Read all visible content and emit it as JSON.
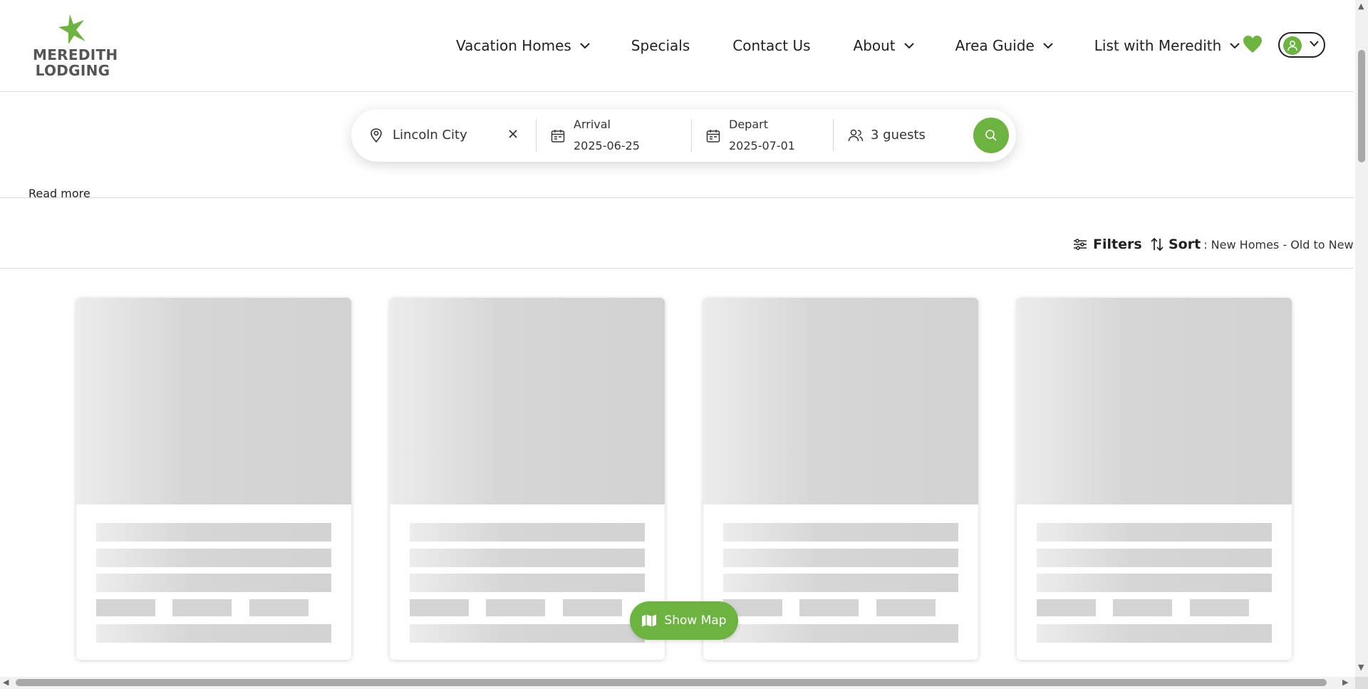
{
  "brand": {
    "line1": "MEREDITH",
    "line2": "LODGING",
    "accent_color": "#6cb33f"
  },
  "nav": {
    "items": [
      {
        "label": "Vacation Homes",
        "has_dropdown": true
      },
      {
        "label": "Specials",
        "has_dropdown": false
      },
      {
        "label": "Contact Us",
        "has_dropdown": false
      },
      {
        "label": "About",
        "has_dropdown": true
      },
      {
        "label": "Area Guide",
        "has_dropdown": true
      },
      {
        "label": "List with Meredith",
        "has_dropdown": true
      }
    ],
    "favorites_icon": "heart-icon",
    "account_icon": "user-icon"
  },
  "search": {
    "location": "Lincoln City",
    "arrival_label": "Arrival",
    "arrival_value": "2025-06-25",
    "depart_label": "Depart",
    "depart_value": "2025-07-01",
    "guests": "3 guests"
  },
  "read_more": "Read more",
  "toolbar": {
    "filters_label": "Filters",
    "sort_label": "Sort",
    "sort_value": ": New Homes - Old to New"
  },
  "listings": {
    "loading_placeholders": 4
  },
  "show_map_label": "Show Map"
}
